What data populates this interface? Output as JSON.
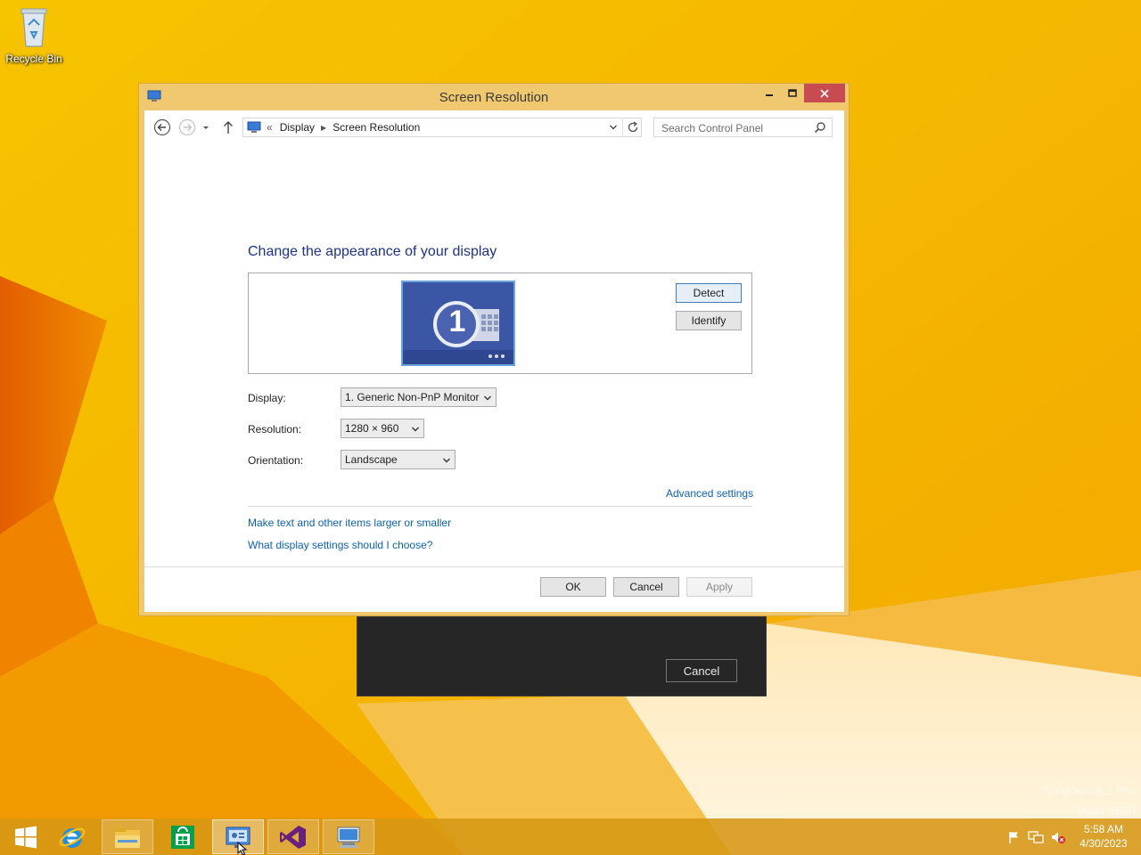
{
  "desktop": {
    "recycle_bin_label": "Recycle Bin",
    "watermark_line1": "Windows 8.1 Pro",
    "watermark_line2": "Build 9600"
  },
  "window": {
    "title": "Screen Resolution",
    "breadcrumb": [
      "Display",
      "Screen Resolution"
    ],
    "breadcrumb_prefix": "«",
    "search_placeholder": "Search Control Panel",
    "heading": "Change the appearance of your display",
    "monitor_number": "1",
    "detect_label": "Detect",
    "identify_label": "Identify",
    "display_label": "Display:",
    "display_value": "1. Generic Non-PnP Monitor",
    "resolution_label": "Resolution:",
    "resolution_value": "1280 × 960",
    "orientation_label": "Orientation:",
    "orientation_value": "Landscape",
    "advanced_link": "Advanced settings",
    "text_size_link": "Make text and other items larger or smaller",
    "help_link": "What display settings should I choose?",
    "ok_label": "OK",
    "cancel_label": "Cancel",
    "apply_label": "Apply"
  },
  "dark_dialog": {
    "cancel_label": "Cancel"
  },
  "taskbar": {
    "items": [
      "start-button",
      "internet-explorer",
      "file-explorer",
      "store",
      "control-panel",
      "visual-studio",
      "remote-desktop"
    ],
    "time": "5:58 AM",
    "date": "4/30/2023"
  },
  "colors": {
    "wallpaper": "#f6b600",
    "heading": "#1e3287",
    "link": "#0b62b6",
    "close_button": "#c74b50"
  }
}
